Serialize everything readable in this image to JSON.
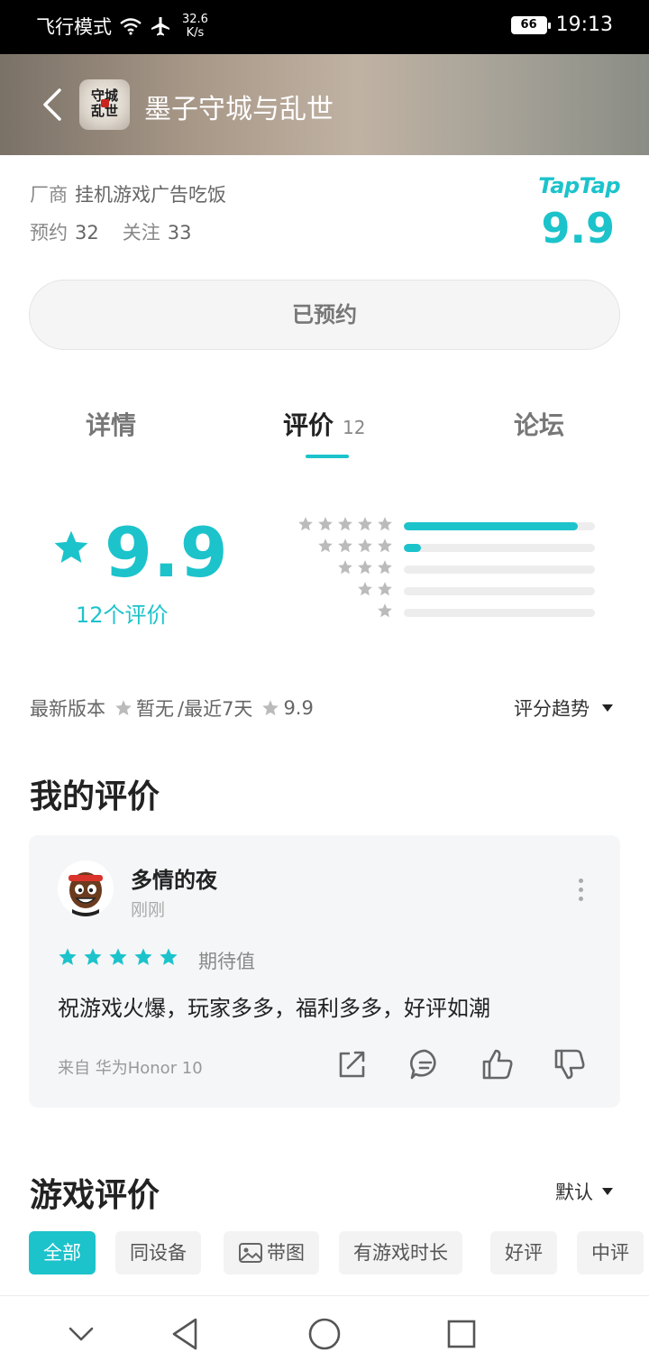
{
  "status_bar": {
    "mode": "飞行模式",
    "speed_value": "32.6",
    "speed_unit": "K/s",
    "battery": "66",
    "time": "19:13"
  },
  "header": {
    "title": "墨子守城与乱世",
    "icon_text": "守城乱世"
  },
  "info": {
    "vendor_label": "厂商",
    "vendor_value": "挂机游戏广告吃饭",
    "reserve_label": "预约",
    "reserve_count": "32",
    "follow_label": "关注",
    "follow_count": "33"
  },
  "taptap": {
    "logo": "TapTap",
    "score": "9.9"
  },
  "reserve_button": "已预约",
  "tabs": [
    {
      "label": "详情"
    },
    {
      "label": "评价",
      "count": "12"
    },
    {
      "label": "论坛"
    }
  ],
  "rating": {
    "score": "9.9",
    "count_text": "12个评价",
    "distribution": [
      {
        "stars": 5,
        "fraction": 0.91
      },
      {
        "stars": 4,
        "fraction": 0.09
      },
      {
        "stars": 3,
        "fraction": 0
      },
      {
        "stars": 2,
        "fraction": 0
      },
      {
        "stars": 1,
        "fraction": 0
      }
    ]
  },
  "version_line": {
    "latest_label": "最新版本",
    "latest_value": "暂无",
    "recent_label": "/最近7天",
    "recent_value": "9.9",
    "trend_label": "评分趋势"
  },
  "my_review": {
    "title": "我的评价",
    "user": "多情的夜",
    "time": "刚刚",
    "stars": 5,
    "tag": "期待值",
    "text": "祝游戏火爆，玩家多多，福利多多，好评如潮",
    "device": "来自 华为Honor 10"
  },
  "game_reviews": {
    "title": "游戏评价",
    "sort_label": "默认",
    "filters": [
      "全部",
      "同设备",
      "带图",
      "有游戏时长",
      "好评",
      "中评"
    ]
  },
  "colors": {
    "accent": "#1cc3cb",
    "text_primary": "#222222",
    "text_secondary": "#888888"
  },
  "icons": {
    "back": "chevron-left-icon",
    "wifi": "wifi-icon",
    "airplane": "airplane-icon",
    "share": "share-icon",
    "comment": "comment-icon",
    "like": "thumbs-up-icon",
    "dislike": "thumbs-down-icon"
  }
}
